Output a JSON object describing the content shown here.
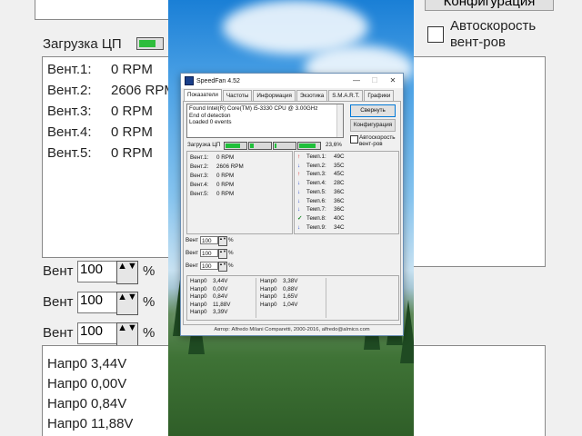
{
  "window": {
    "title": "SpeedFan 4.52",
    "minimize": "—",
    "maximize": "☐",
    "close": "✕",
    "tabs": [
      "Показатели",
      "Частоты",
      "Информация",
      "Экзотика",
      "S.M.A.R.T.",
      "Графики"
    ],
    "log_lines": [
      "Found Intel(R) Core(TM) i5-3330 CPU @ 3.00GHz",
      "End of detection",
      "Loaded 0 events"
    ],
    "minimize_button": "Свернуть",
    "config_button": "Конфигурация",
    "autospeed_label": "Автоскорость вент-ров",
    "cpu_label": "Загрузка ЦП",
    "cpu_cores_fill": [
      0.8,
      0.2,
      0.1,
      0.9
    ],
    "cpu_percent": "23,6%",
    "fans": [
      {
        "label": "Вент.1:",
        "value": "0 RPM"
      },
      {
        "label": "Вент.2:",
        "value": "2606 RPM"
      },
      {
        "label": "Вент.3:",
        "value": "0 RPM"
      },
      {
        "label": "Вент.4:",
        "value": "0 RPM"
      },
      {
        "label": "Вент.5:",
        "value": "0 RPM"
      }
    ],
    "temps": [
      {
        "icon": "up",
        "label": "Темп.1:",
        "value": "49C"
      },
      {
        "icon": "down",
        "label": "Темп.2:",
        "value": "35C"
      },
      {
        "icon": "up",
        "label": "Темп.3:",
        "value": "45C"
      },
      {
        "icon": "down",
        "label": "Темп.4:",
        "value": "28C"
      },
      {
        "icon": "down",
        "label": "Темп.5:",
        "value": "36C"
      },
      {
        "icon": "down",
        "label": "Темп.6:",
        "value": "36C"
      },
      {
        "icon": "down",
        "label": "Темп.7:",
        "value": "36C"
      },
      {
        "icon": "ok",
        "label": "Темп.8:",
        "value": "40C"
      },
      {
        "icon": "down",
        "label": "Темп.9:",
        "value": "34C"
      }
    ],
    "fan_speed_label": "Вент",
    "fan_speed_values": [
      "100",
      "100",
      "100"
    ],
    "percent_sign": "%",
    "voltages_left": [
      {
        "label": "Напр0",
        "value": "3,44V"
      },
      {
        "label": "Напр0",
        "value": "0,00V"
      },
      {
        "label": "Напр0",
        "value": "0,84V"
      },
      {
        "label": "Напр0",
        "value": "11,88V"
      },
      {
        "label": "Напр0",
        "value": "3,39V"
      }
    ],
    "voltages_right": [
      {
        "label": "Напр0",
        "value": "3,38V"
      },
      {
        "label": "Напр0",
        "value": "0,88V"
      },
      {
        "label": "Напр0",
        "value": "1,65V"
      },
      {
        "label": "Напр0",
        "value": "1,04V"
      }
    ],
    "statusbar": "Автор: Alfredo Milani Comparetti, 2000-2016, alfredo@almico.com"
  },
  "background": {
    "left_cpu_label": "Загрузка ЦП",
    "left_fans": [
      {
        "label": "Вент.1:",
        "value": "0 RPM"
      },
      {
        "label": "Вент.2:",
        "value": "2606 RPM"
      },
      {
        "label": "Вент.3:",
        "value": "0 RPM"
      },
      {
        "label": "Вент.4:",
        "value": "0 RPM"
      },
      {
        "label": "Вент.5:",
        "value": "0 RPM"
      }
    ],
    "left_fan_label": "Вент",
    "left_fan_values": [
      "100",
      "100",
      "100"
    ],
    "left_percent": "%",
    "left_volts": [
      {
        "label": "Напр0",
        "value": "3,44V"
      },
      {
        "label": "Напр0",
        "value": "0,00V"
      },
      {
        "label": "Напр0",
        "value": "0,84V"
      },
      {
        "label": "Напр0",
        "value": "11,88V"
      }
    ],
    "right_button": "Конфигурация",
    "right_autospeed_1": "Автоскорость",
    "right_autospeed_2": "вент-ров"
  }
}
